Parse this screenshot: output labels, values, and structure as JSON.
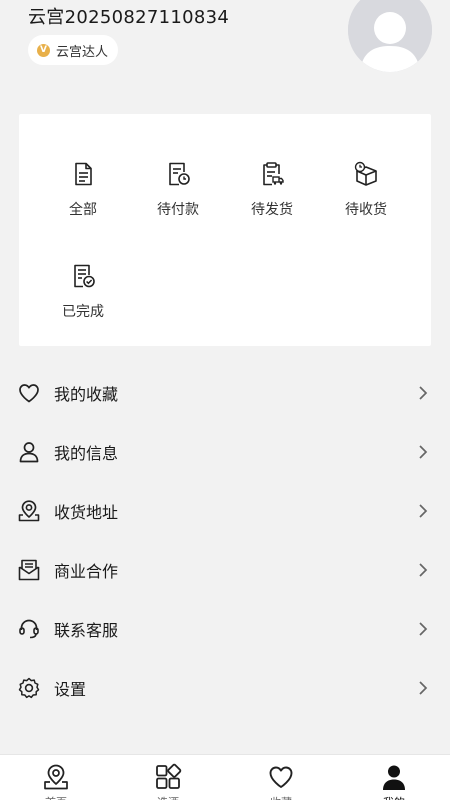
{
  "profile": {
    "username": "云宫20250827110834",
    "badge_icon_letter": "V",
    "badge_label": "云宫达人",
    "avatar_icon": "default-avatar-icon"
  },
  "orders": {
    "items": [
      {
        "label": "全部",
        "icon": "document-icon"
      },
      {
        "label": "待付款",
        "icon": "document-clock-icon"
      },
      {
        "label": "待发货",
        "icon": "clipboard-truck-icon"
      },
      {
        "label": "待收货",
        "icon": "box-clock-icon"
      },
      {
        "label": "已完成",
        "icon": "document-check-icon"
      }
    ]
  },
  "menu": {
    "items": [
      {
        "label": "我的收藏",
        "icon": "heart-icon"
      },
      {
        "label": "我的信息",
        "icon": "user-icon"
      },
      {
        "label": "收货地址",
        "icon": "location-pin-icon"
      },
      {
        "label": "商业合作",
        "icon": "envelope-icon"
      },
      {
        "label": "联系客服",
        "icon": "headset-icon"
      },
      {
        "label": "设置",
        "icon": "gear-icon"
      }
    ]
  },
  "tabbar": {
    "items": [
      {
        "label": "首页",
        "icon": "map-pin-icon"
      },
      {
        "label": "选酒",
        "icon": "grid-icon"
      },
      {
        "label": "收藏",
        "icon": "heart-outline-icon"
      },
      {
        "label": "我的",
        "icon": "person-filled-icon"
      }
    ],
    "active_index": 3
  },
  "colors": {
    "background": "#f2f2f2",
    "badge_dot": "#e8b04a",
    "avatar_bg": "#d8d9de",
    "text_primary": "#1a1a1a"
  }
}
